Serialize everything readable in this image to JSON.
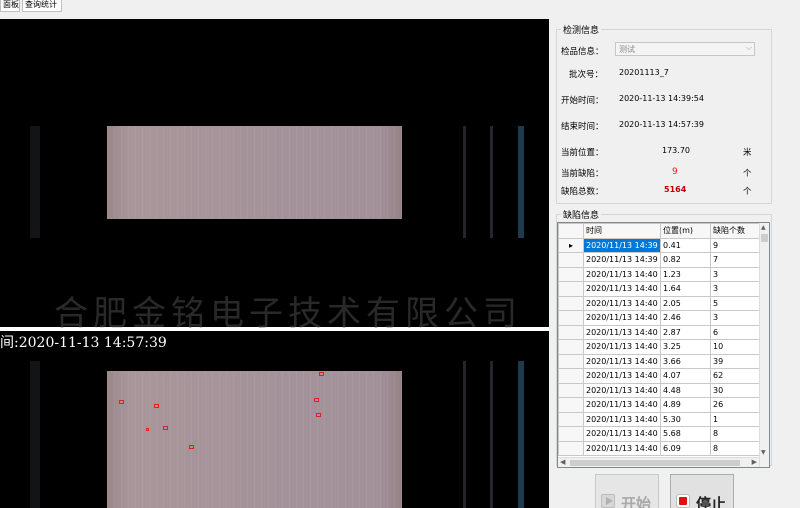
{
  "tabs": [
    "面板",
    "查询统计"
  ],
  "detect_info": {
    "title": "检测信息",
    "product_label": "检品信息：",
    "product_value": "测试",
    "batch_label": "批次号：",
    "batch_value": "20201113_7",
    "start_label": "开始时间：",
    "start_value": "2020-11-13 14:39:54",
    "end_label": "结束时间：",
    "end_value": "2020-11-13 14:57:39",
    "position_label": "当前位置：",
    "position_value": "173.70",
    "position_unit": "米",
    "cur_defect_label": "当前缺陷：",
    "cur_defect_value": "9",
    "cur_defect_unit": "个",
    "total_defect_label": "缺陷总数：",
    "total_defect_value": "5164",
    "total_defect_unit": "个"
  },
  "defect_info": {
    "title": "缺陷信息",
    "columns": [
      "时间",
      "位置(m)",
      "缺陷个数"
    ],
    "rows": [
      [
        "2020/11/13 14:39",
        "0.41",
        "9"
      ],
      [
        "2020/11/13 14:39",
        "0.82",
        "7"
      ],
      [
        "2020/11/13 14:40",
        "1.23",
        "3"
      ],
      [
        "2020/11/13 14:40",
        "1.64",
        "3"
      ],
      [
        "2020/11/13 14:40",
        "2.05",
        "5"
      ],
      [
        "2020/11/13 14:40",
        "2.46",
        "3"
      ],
      [
        "2020/11/13 14:40",
        "2.87",
        "6"
      ],
      [
        "2020/11/13 14:40",
        "3.25",
        "10"
      ],
      [
        "2020/11/13 14:40",
        "3.66",
        "39"
      ],
      [
        "2020/11/13 14:40",
        "4.07",
        "62"
      ],
      [
        "2020/11/13 14:40",
        "4.48",
        "30"
      ],
      [
        "2020/11/13 14:40",
        "4.89",
        "26"
      ],
      [
        "2020/11/13 14:40",
        "5.30",
        "1"
      ],
      [
        "2020/11/13 14:40",
        "5.68",
        "8"
      ],
      [
        "2020/11/13 14:40",
        "6.09",
        "8"
      ]
    ]
  },
  "view": {
    "watermark": "合肥金铭电子技术有限公司",
    "timestamp": "间:2020-11-13 14:57:39"
  },
  "buttons": {
    "start": "开始",
    "stop": "停止"
  },
  "colors": {
    "selection": "#0078d7",
    "defect_value": "#e02020",
    "total_value": "#c00000",
    "defect_box": "#e02020"
  }
}
